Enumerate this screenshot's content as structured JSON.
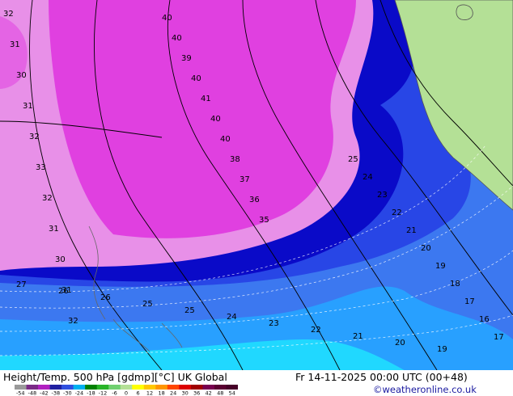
{
  "title": "Height/Temp. 500 hPa [gdmp][°C] UK Global",
  "datetime": "Fr 14-11-2025 00:00 UTC (00+48)",
  "credit": "©weatheronline.co.uk",
  "legend": {
    "ticks": [
      "-54",
      "-48",
      "-42",
      "-38",
      "-30",
      "-24",
      "-18",
      "-12",
      "-6",
      "0",
      "6",
      "12",
      "18",
      "24",
      "30",
      "36",
      "42",
      "48",
      "54"
    ],
    "colors": [
      "#9a9a9a",
      "#7a2a86",
      "#b020c0",
      "#2020a0",
      "#3050e0",
      "#00b0f0",
      "#008000",
      "#28b428",
      "#70d070",
      "#b4e096",
      "#ffff00",
      "#ffc800",
      "#ff9600",
      "#ff4600",
      "#dc0000",
      "#a00000",
      "#780050",
      "#5a0032",
      "#460028"
    ]
  },
  "colors": {
    "land": "#b4e096",
    "violet": "#e890e8",
    "magenta": "#e040e0",
    "deep_blue": "#0a0ac8",
    "blue": "#2846e6",
    "light_blue": "#3c78f0",
    "sky": "#28a0ff",
    "cyan": "#20d8ff"
  },
  "contour_labels": {
    "west": [
      "32",
      "31",
      "30",
      "31",
      "32",
      "33",
      "32",
      "31",
      "30",
      "31",
      "32"
    ],
    "center": [
      "40",
      "40",
      "39",
      "40",
      "41",
      "40",
      "40",
      "38",
      "37",
      "36",
      "35"
    ],
    "south": [
      "27",
      "26",
      "26",
      "25",
      "25",
      "24",
      "23",
      "22",
      "21",
      "20",
      "19"
    ],
    "east": [
      "25",
      "24",
      "23",
      "22",
      "21",
      "20",
      "19",
      "18",
      "17",
      "16",
      "17"
    ]
  }
}
